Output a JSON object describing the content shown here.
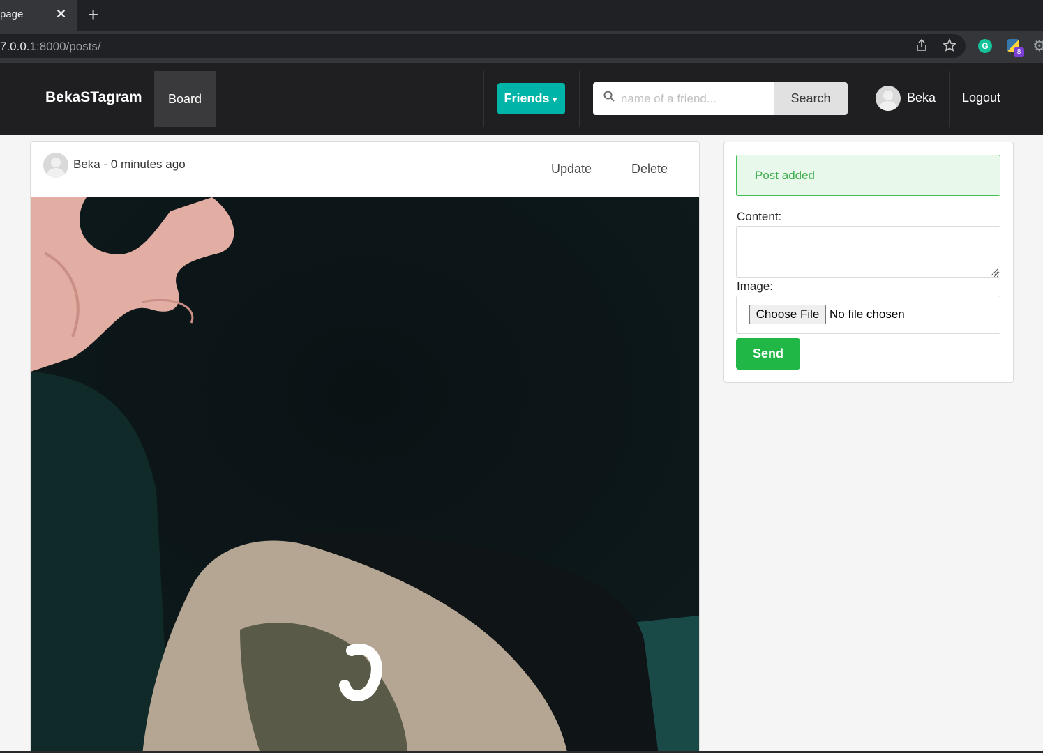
{
  "browser": {
    "tab_title": "page",
    "tab_close": "✕",
    "new_tab": "+",
    "url_host": "7.0.0.1",
    "url_path": ":8000/posts/",
    "grammarly_letter": "G",
    "extension_badge": "8"
  },
  "navbar": {
    "brand": "BekaSTagram",
    "board_label": "Board",
    "friends_label": "Friends",
    "search_placeholder": "name of a friend...",
    "search_button": "Search",
    "user_name": "Beka",
    "logout_label": "Logout"
  },
  "post": {
    "author_line": "Beka - 0 minutes ago",
    "update_label": "Update",
    "delete_label": "Delete"
  },
  "form": {
    "notice": "Post added",
    "content_label": "Content:",
    "content_value": "",
    "image_label": "Image:",
    "choose_file_label": "Choose File",
    "file_status": "No file chosen",
    "send_label": "Send"
  },
  "colors": {
    "navbar_bg": "#1f1f21",
    "friends_btn": "#00b5a7",
    "send_btn": "#21b747",
    "notice_border": "#3fbf55",
    "notice_bg": "#e8f8ea"
  }
}
